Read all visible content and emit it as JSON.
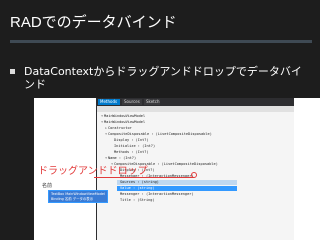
{
  "slide": {
    "title": "RADでのデータバインド",
    "bullet": "DataContextからドラッグアンドドロップでデータバインド"
  },
  "screenshot": {
    "tabs": [
      "Methods",
      "Sources",
      "Sketch"
    ],
    "tree": [
      "MainWindowViewModel",
      "MainWindowViewModel",
      "Constructor",
      "CompositeDisposable : (LivetCompositeDisposable)",
      "Display : (Int?)",
      "Initialize : (Int?)",
      "Methods : (Int?)",
      "Name : (Int?)",
      "CompositeDisposable : (LivetCompositeDisposable)",
      "Display : (Int?)",
      "Messenger : (InteractionMessenger)",
      "Sources : (string)",
      "Value : (string)",
      "Messenger : (InteractionMessenger)",
      "Title : (String)"
    ],
    "drag_label": "ドラッグアンドドロップ",
    "drop_caption": "名前",
    "drop_lines": [
      "TextBox MainWindowViewModel",
      "Binding 名前 データの表示"
    ]
  }
}
